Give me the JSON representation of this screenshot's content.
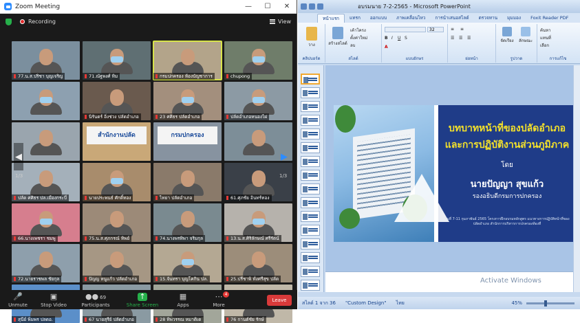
{
  "zoom": {
    "window_title": "Zoom Meeting",
    "recording_label": "Recording",
    "view_label": "View",
    "window_buttons": [
      "—",
      "☐",
      "✕"
    ],
    "page_left": "1/3",
    "page_right": "1/3",
    "participants": [
      {
        "name": "77.น.ส.ปริชา บุญเจริญ",
        "bg": "#7b8f9e",
        "sign": ""
      },
      {
        "name": "71.ณัฐพงศ์ ทิม",
        "bg": "#5f6f73",
        "sign": ""
      },
      {
        "name": "กรมปกครอง ห้องบัญชาการ",
        "bg": "#b3a48a",
        "sign": ""
      },
      {
        "name": "chupong",
        "bg": "#6f7d6a",
        "sign": ""
      },
      {
        "name": "",
        "bg": "#8da0b0",
        "sign": ""
      },
      {
        "name": "นิรันดร์ อิ่งช่วง ปลัดอำเภอ",
        "bg": "#6a5a4e",
        "sign": ""
      },
      {
        "name": "23 ศศิธร ปลัดอำเภอ",
        "bg": "#a38f7d",
        "sign": ""
      },
      {
        "name": "ปลัดอำเภอหนองไผ่",
        "bg": "#8c9aa4",
        "sign": ""
      },
      {
        "name": "",
        "bg": "#9aa5ae",
        "sign": ""
      },
      {
        "name": "",
        "bg": "#c9a878",
        "sign": "สำนักงานปลัด"
      },
      {
        "name": "",
        "bg": "#8793a0",
        "sign": "กรมปกครอง"
      },
      {
        "name": "",
        "bg": "#7d8e98",
        "sign": ""
      },
      {
        "name": "ปลัด ศศิธร ปล.เมืองกระบี่",
        "bg": "#a4b0ba",
        "sign": ""
      },
      {
        "name": "นายประพนธ์ ศักดิ์ทอง",
        "bg": "#a88c6c",
        "sign": ""
      },
      {
        "name": "ไทยา ปลัดอำเภอ",
        "bg": "#8a7a6a",
        "sign": ""
      },
      {
        "name": "61.ศุภชัย อินทร์ทอง",
        "bg": "#3a4048",
        "sign": ""
      },
      {
        "name": "66.นางเพชรา ชมพู",
        "bg": "#d67e8e",
        "sign": ""
      },
      {
        "name": "75.น.ส.ศุภกรณ์ ทิพย์",
        "bg": "#9c8a78",
        "sign": ""
      },
      {
        "name": "74.นางพรทิพา จริมกุล",
        "bg": "#7a8a90",
        "sign": ""
      },
      {
        "name": "13.น.ส.ศิริลักษณ์ ศรีรัตน์",
        "bg": "#b6b2ac",
        "sign": ""
      },
      {
        "name": "72.นายราชพล ชัยกุล",
        "bg": "#8e9fac",
        "sign": ""
      },
      {
        "name": "ปัญญ หนูแก้ว ปลัดอำเภอ",
        "bg": "#a69784",
        "sign": ""
      },
      {
        "name": "15.จันทรา บุญโคกิน ปล.",
        "bg": "#b4a893",
        "sign": ""
      },
      {
        "name": "25.ปรีชาพิ ทั่งศรีสุข ปลัด",
        "bg": "#9c8d7a",
        "sign": ""
      },
      {
        "name": "สุนีย์ พิมพร ปลดอ.",
        "bg": "#5b8fc9",
        "sign": ""
      },
      {
        "name": "67 นายสุรีย์ ปลัดอำเภอ",
        "bg": "#8a9aa2",
        "sign": ""
      },
      {
        "name": "28 ทิพวรรณ หมาดิเด",
        "bg": "#a2a69a",
        "sign": ""
      },
      {
        "name": "76 กานต์ชัย รักษ์",
        "bg": "#c0b8a8",
        "sign": ""
      }
    ],
    "controls": {
      "unmute": "Unmute",
      "stop_video": "Stop Video",
      "participants": "Participants",
      "participants_count": "69",
      "share_screen": "Share Screen",
      "apps": "Apps",
      "more": "More",
      "more_badge": "4",
      "leave": "Leave"
    }
  },
  "ppt": {
    "window_title": "อบรมนาย 7-2-2565 - Microsoft PowerPoint",
    "tabs": [
      "หน้าแรก",
      "แทรก",
      "ออกแบบ",
      "ภาพเคลื่อนไหว",
      "การนำเสนอสไลด์",
      "ตรวจทาน",
      "มุมมอง",
      "Foxit Reader PDF"
    ],
    "groups": [
      "คลิปบอร์ด",
      "สไลด์",
      "แบบอักษร",
      "ย่อหน้า",
      "รูปวาด",
      "การแก้ไข"
    ],
    "buttons": {
      "paste": "วาง",
      "new_slide": "สร้างสไลด์",
      "layout": "เค้าโครง",
      "reset": "ตั้งค่าใหม่",
      "delete": "ลบ",
      "arrange": "จัดเรียง",
      "quick_styles": "ลักษณะ",
      "find": "ค้นหา",
      "replace": "แทนที่",
      "select": "เลือก"
    },
    "font_size": "32",
    "slide": {
      "title_line1": "บทบาทหน้าที่ของปลัดอำเภอ",
      "title_line2": "และการปฏิบัติงานส่วนภูมิภาค",
      "by": "โดย",
      "presenter": "นายปัญญา สุขแก้ว",
      "position": "รองอธิบดีกรมการปกครอง",
      "footer": "วันที่ 7-11 กุมภาพันธ์ 2565 โครงการฝึกอบรมหลักสูตร แนวทางการปฏิบัติหน้าที่ของปลัดอำเภอ สำนักการบริหารการปกครองท้องที่"
    },
    "activate": "Activate Windows",
    "status": {
      "slide_of": "สไลด์ 1 จาก 36",
      "theme": "\"Custom Design\"",
      "language": "ไทย",
      "zoom": "45%"
    }
  }
}
